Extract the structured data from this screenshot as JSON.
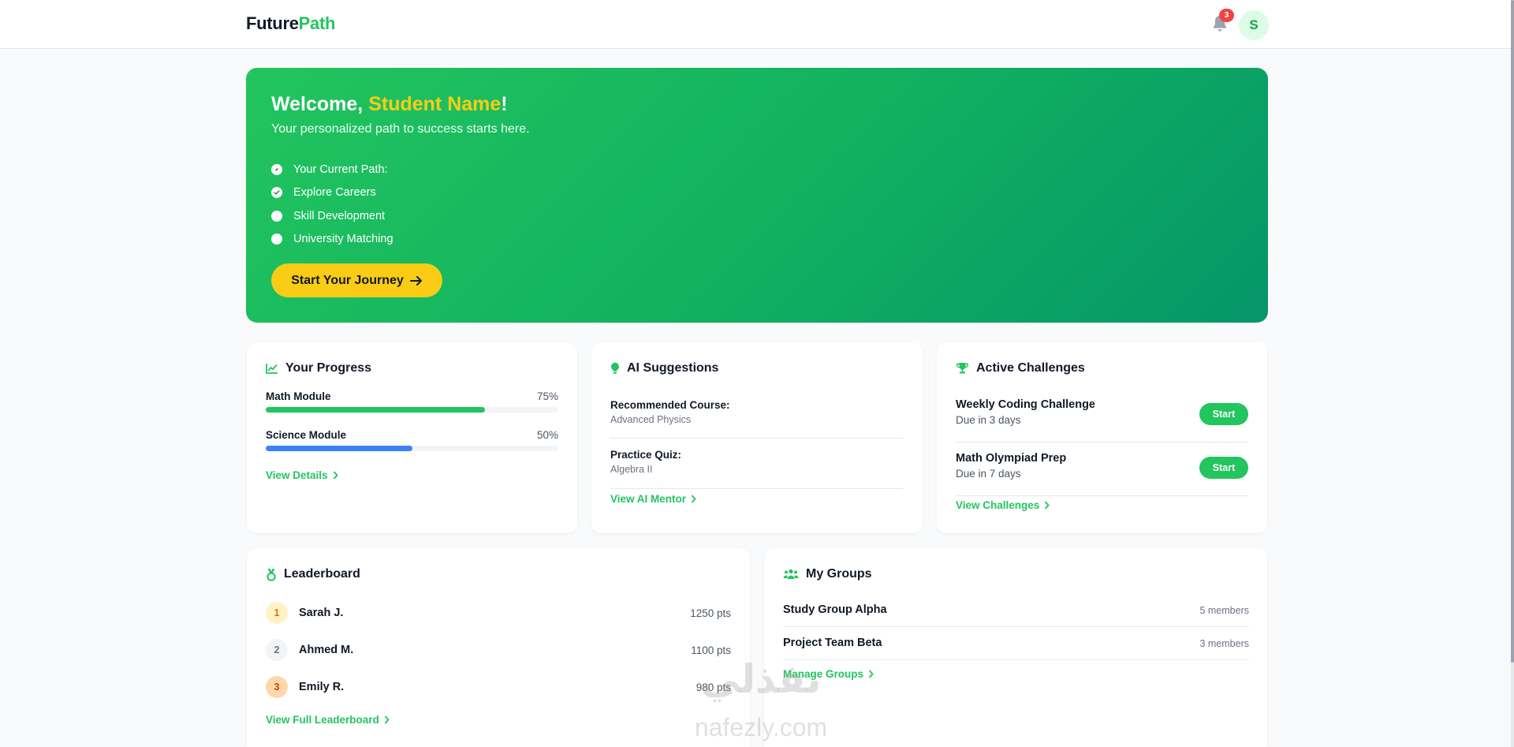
{
  "header": {
    "brand_part1": "Future",
    "brand_part2": "Path",
    "notification_count": "3",
    "avatar_initial": "S"
  },
  "hero": {
    "welcome": "Welcome, ",
    "student_name": "Student Name",
    "exclaim": "!",
    "subtitle": "Your personalized path to success starts here.",
    "path_items": [
      {
        "label": "Your Current Path:",
        "icon": "compass-icon"
      },
      {
        "label": "Explore Careers",
        "icon": "check-circle-icon"
      },
      {
        "label": "Skill Development",
        "icon": "empty-circle-icon"
      },
      {
        "label": "University Matching",
        "icon": "empty-circle-icon"
      }
    ],
    "cta_label": "Start Your Journey"
  },
  "progress": {
    "title": "Your Progress",
    "items": [
      {
        "label": "Math Module",
        "percent_label": "75%",
        "value": 0.75,
        "color": "#22c55e"
      },
      {
        "label": "Science Module",
        "percent_label": "50%",
        "value": 0.5,
        "color": "#3b82f6"
      }
    ],
    "link": "View Details"
  },
  "ai": {
    "title": "AI Suggestions",
    "items": [
      {
        "label": "Recommended Course:",
        "value": "Advanced Physics"
      },
      {
        "label": "Practice Quiz:",
        "value": "Algebra II"
      }
    ],
    "link": "View AI Mentor"
  },
  "challenges": {
    "title": "Active Challenges",
    "items": [
      {
        "name": "Weekly Coding Challenge",
        "due": "Due in 3 days",
        "button": "Start"
      },
      {
        "name": "Math Olympiad Prep",
        "due": "Due in 7 days",
        "button": "Start"
      }
    ],
    "link": "View Challenges"
  },
  "leaderboard": {
    "title": "Leaderboard",
    "rows": [
      {
        "rank": "1",
        "name": "Sarah J.",
        "points": "1250 pts"
      },
      {
        "rank": "2",
        "name": "Ahmed M.",
        "points": "1100 pts"
      },
      {
        "rank": "3",
        "name": "Emily R.",
        "points": "980 pts"
      }
    ],
    "link": "View Full Leaderboard"
  },
  "groups": {
    "title": "My Groups",
    "rows": [
      {
        "name": "Study Group Alpha",
        "members": "5 members"
      },
      {
        "name": "Project Team Beta",
        "members": "3 members"
      }
    ],
    "link": "Manage Groups"
  },
  "watermark": {
    "arabic": "نفذلي",
    "latin": "nafezly.com"
  },
  "colors": {
    "accent": "#22c55e",
    "highlight": "#facc15",
    "blue": "#3b82f6",
    "badge": "#ef4444"
  }
}
